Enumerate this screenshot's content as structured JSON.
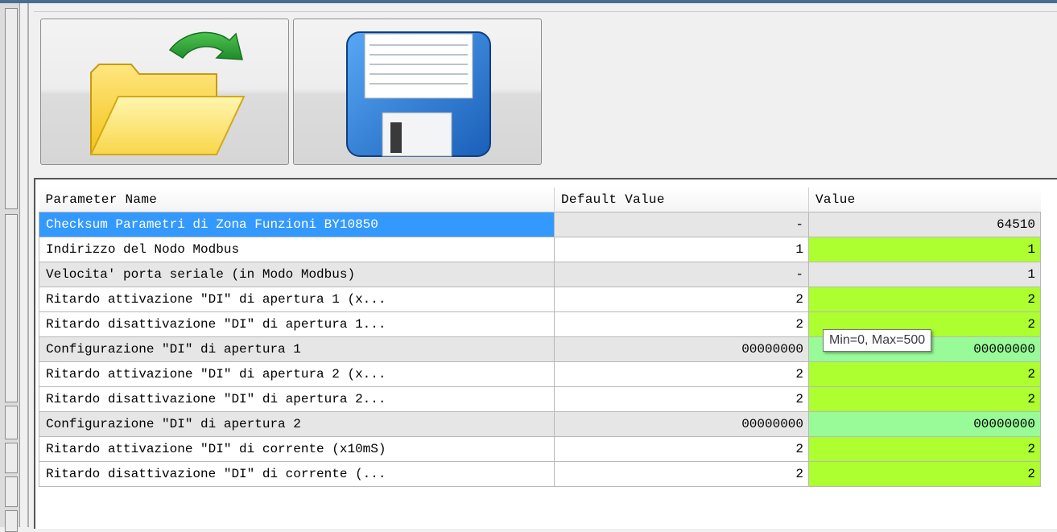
{
  "toolbar": {
    "open_icon": "folder-open-icon",
    "save_icon": "floppy-save-icon"
  },
  "table": {
    "columns": [
      "Parameter Name",
      "Default Value",
      "Value"
    ],
    "rows": [
      {
        "name": "Checksum Parametri di Zona Funzioni BY10850",
        "default": "-",
        "value": "64510"
      },
      {
        "name": "Indirizzo del Nodo Modbus",
        "default": "1",
        "value": "1"
      },
      {
        "name": "Velocita' porta seriale (in Modo Modbus)",
        "default": "-",
        "value": "1"
      },
      {
        "name": "Ritardo attivazione \"DI\" di apertura 1 (x...",
        "default": "2",
        "value": "2"
      },
      {
        "name": "Ritardo disattivazione \"DI\" di apertura 1...",
        "default": "2",
        "value": "2"
      },
      {
        "name": "Configurazione \"DI\" di apertura 1",
        "default": "00000000",
        "value": "00000000"
      },
      {
        "name": "Ritardo attivazione \"DI\" di apertura 2 (x...",
        "default": "2",
        "value": "2"
      },
      {
        "name": "Ritardo disattivazione \"DI\" di apertura 2...",
        "default": "2",
        "value": "2"
      },
      {
        "name": "Configurazione \"DI\" di apertura 2",
        "default": "00000000",
        "value": "00000000"
      },
      {
        "name": "Ritardo attivazione \"DI\" di corrente (x10mS)",
        "default": "2",
        "value": "2"
      },
      {
        "name": "Ritardo disattivazione \"DI\" di corrente (...",
        "default": "2",
        "value": "2"
      }
    ]
  },
  "tooltip": {
    "text": "Min=0, Max=500"
  },
  "colors": {
    "selection": "#3399ff",
    "value_editable": "#adff2f",
    "value_config": "#98fb98",
    "row_gray": "#e6e6e6"
  }
}
